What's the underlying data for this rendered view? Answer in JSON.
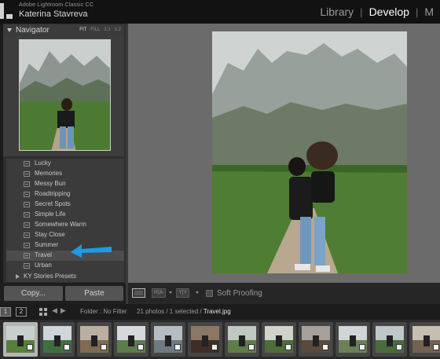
{
  "app": {
    "product": "Adobe Lightroom Classic CC",
    "user": "Katerina Stavreva",
    "modules": [
      {
        "label": "Library",
        "active": false
      },
      {
        "label": "Develop",
        "active": true
      },
      {
        "label": "M",
        "active": false
      }
    ]
  },
  "navigator": {
    "title": "Navigator",
    "zoom_options": [
      "FIT",
      "FILL",
      "1:1",
      "1:2"
    ],
    "active_zoom": "FIT"
  },
  "presets": {
    "items": [
      "Lucky",
      "Memories",
      "Messy Bun",
      "Roadtripping",
      "Secret Spots",
      "Simple Life",
      "Somewhere Warm",
      "Stay Close",
      "Summer",
      "Travel",
      "Urban"
    ],
    "selected": "Travel",
    "group": "KY Stories Presets"
  },
  "buttons": {
    "copy": "Copy...",
    "paste": "Paste"
  },
  "toolbar": {
    "ry1": "R|A",
    "ry2": "Y|Y",
    "soft_proofing": "Soft Proofing"
  },
  "filmstrip": {
    "view1": "1",
    "view2": "2",
    "source": "Folder : No Filter",
    "count": "21 photos / 1 selected /",
    "file": "Travel.jpg",
    "thumbs": 12,
    "selected_index": 0
  },
  "colors": {
    "accent_arrow": "#1e9be6",
    "canvas": "#6b6b6b",
    "panel": "#3b3b3b",
    "active_module": "#ffffff"
  },
  "icons": [
    "lightroom-logo-icon",
    "collapse-triangle-icon",
    "preset-icon",
    "expand-triangle-icon",
    "arrow-pointer-icon",
    "loupe-view-icon",
    "grid-icon",
    "nav-arrows-icon"
  ]
}
